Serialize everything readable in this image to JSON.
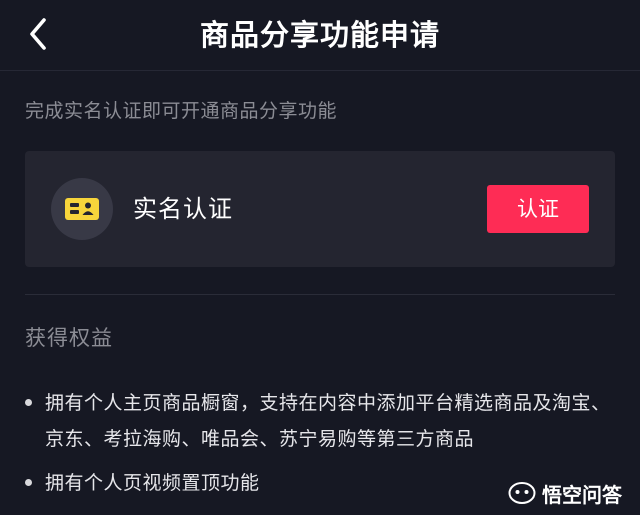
{
  "nav": {
    "title": "商品分享功能申请"
  },
  "hint": "完成实名认证即可开通商品分享功能",
  "verification": {
    "label": "实名认证",
    "button_label": "认证",
    "icon": "id-card-icon",
    "accent": "#fe2c55",
    "icon_color": "#f7d53b"
  },
  "benefits": {
    "title": "获得权益",
    "items": [
      "拥有个人主页商品橱窗，支持在内容中添加平台精选商品及淘宝、京东、考拉海购、唯品会、苏宁易购等第三方商品",
      "拥有个人页视频置顶功能"
    ]
  },
  "watermark": {
    "text": "悟空问答",
    "icon": "wukong-logo-icon"
  }
}
